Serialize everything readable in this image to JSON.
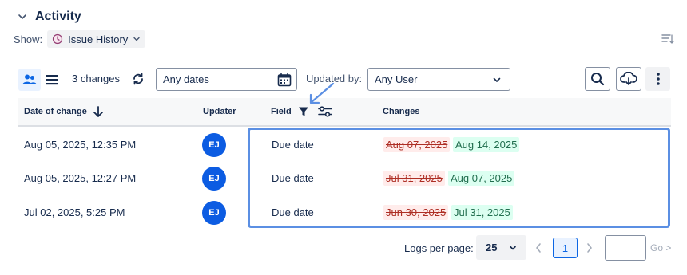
{
  "section": {
    "title": "Activity"
  },
  "show": {
    "label": "Show:",
    "selected": "Issue History"
  },
  "toolbar": {
    "changes_count": "3 changes",
    "date_filter": "Any dates",
    "updated_by_label": "Updated by:",
    "user_filter": "Any User"
  },
  "table": {
    "headers": {
      "date": "Date of change",
      "updater": "Updater",
      "field": "Field",
      "changes": "Changes"
    },
    "rows": [
      {
        "date": "Aug 05, 2025, 12:35 PM",
        "updater_initials": "EJ",
        "field": "Due date",
        "old_value": "Aug 07, 2025",
        "new_value": "Aug 14, 2025"
      },
      {
        "date": "Aug 05, 2025, 12:27 PM",
        "updater_initials": "EJ",
        "field": "Due date",
        "old_value": "Jul 31, 2025",
        "new_value": "Aug 07, 2025"
      },
      {
        "date": "Jul 02, 2025, 5:25 PM",
        "updater_initials": "EJ",
        "field": "Due date",
        "old_value": "Jun 30, 2025",
        "new_value": "Jul 31, 2025"
      }
    ]
  },
  "pagination": {
    "logs_per_page_label": "Logs per page:",
    "per_page": "25",
    "current_page": "1",
    "goto_value": "",
    "go_label": "Go >"
  },
  "colors": {
    "accent": "#0c66e4",
    "avatar": "#0c5ce2",
    "old_value_bg": "#ffeceb",
    "new_value_bg": "#dcfff1",
    "highlight": "#5b8fe3"
  },
  "icons": {
    "collapse": "chevron-down-icon",
    "issue_history": "clock-icon",
    "view_people": "people-icon",
    "view_list": "list-icon",
    "refresh": "refresh-icon",
    "calendar": "calendar-icon",
    "search": "search-icon",
    "download": "cloud-download-icon",
    "more": "more-vertical-icon",
    "sort": "arrow-down-icon",
    "filter": "filter-icon",
    "settings": "sliders-icon"
  }
}
